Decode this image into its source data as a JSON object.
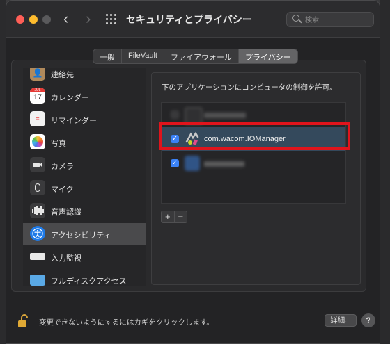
{
  "window": {
    "title": "セキュリティとプライバシー"
  },
  "search": {
    "placeholder": "検索"
  },
  "tabs": [
    {
      "label": "一般",
      "active": false
    },
    {
      "label": "FileVault",
      "active": false
    },
    {
      "label": "ファイアウォール",
      "active": false
    },
    {
      "label": "プライバシー",
      "active": true
    }
  ],
  "sidebar": {
    "items": [
      {
        "label": "連絡先",
        "icon": "contacts-icon"
      },
      {
        "label": "カレンダー",
        "icon": "calendar-icon",
        "calendar_month": "JUL",
        "calendar_day": "17"
      },
      {
        "label": "リマインダー",
        "icon": "reminders-icon"
      },
      {
        "label": "写真",
        "icon": "photos-icon"
      },
      {
        "label": "カメラ",
        "icon": "camera-icon"
      },
      {
        "label": "マイク",
        "icon": "microphone-icon"
      },
      {
        "label": "音声認識",
        "icon": "speech-recognition-icon"
      },
      {
        "label": "アクセシビリティ",
        "icon": "accessibility-icon",
        "selected": true
      },
      {
        "label": "入力監視",
        "icon": "keyboard-icon"
      },
      {
        "label": "フルディスクアクセス",
        "icon": "folder-icon"
      }
    ]
  },
  "panel": {
    "description": "下のアプリケーションにコンピュータの制御を許可。",
    "apps": [
      {
        "label": "",
        "checked": false,
        "blurred": true
      },
      {
        "label": "com.wacom.IOManager",
        "checked": true,
        "selected": true,
        "highlighted": true
      },
      {
        "label": "",
        "checked": true,
        "blurred": true
      }
    ],
    "add_label": "+",
    "remove_label": "−"
  },
  "footer": {
    "lock_text": "変更できないようにするにはカギをクリックします。",
    "advanced_label": "詳細...",
    "help_label": "?"
  },
  "colors": {
    "highlight": "#e0141c",
    "checkbox_on": "#3b82f6",
    "selected_row": "#34495c"
  }
}
